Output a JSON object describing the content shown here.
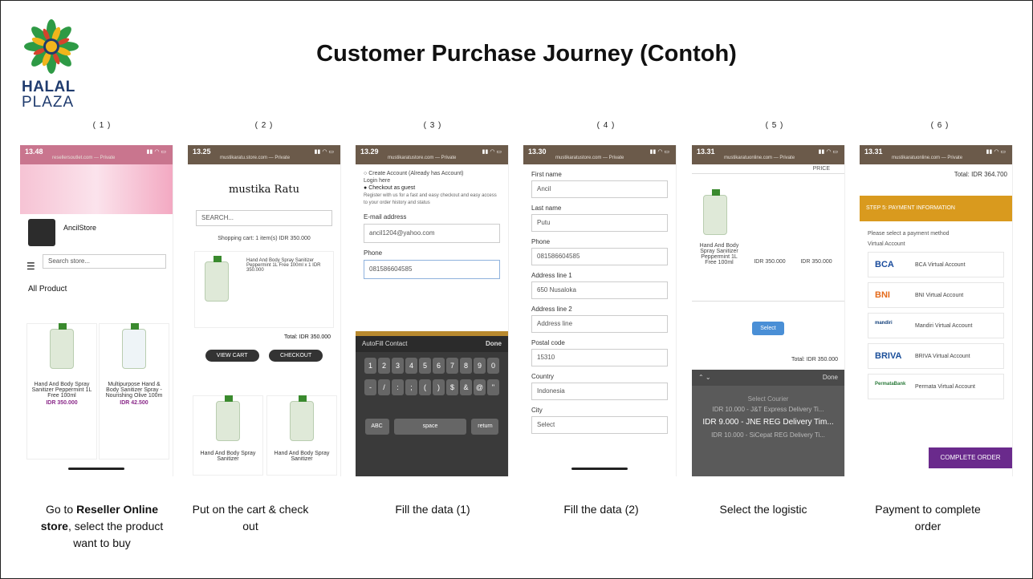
{
  "logo": {
    "line1": "HALAL",
    "line2": "PLAZA"
  },
  "title": "Customer Purchase Journey (Contoh)",
  "steps": [
    {
      "num": "( 1 )",
      "caption_pre": "Go to ",
      "caption_bold": "Reseller Online store",
      "caption_post": ", select the product want to buy"
    },
    {
      "num": "( 2 )",
      "caption": "Put on the cart & check out"
    },
    {
      "num": "( 3 )",
      "caption": "Fill the data (1)"
    },
    {
      "num": "( 4 )",
      "caption": "Fill the data (2)"
    },
    {
      "num": "( 5 )",
      "caption": "Select the logistic"
    },
    {
      "num": "( 6 )",
      "caption": "Payment to complete order"
    }
  ],
  "screen1": {
    "time": "13.48",
    "url": "resellersoutlet.com — Private",
    "store_name": "AncilStore",
    "search_placeholder": "Search store...",
    "section": "All Product",
    "products": [
      {
        "name": "Hand And Body Spray Sanitizer Peppermint 1L Free 100ml",
        "price": "IDR 350.000"
      },
      {
        "name": "Multipurpose Hand & Body Sanitizer Spray - Nourishing Olive 100m",
        "price": "IDR 42.500"
      }
    ]
  },
  "screen2": {
    "time": "13.25",
    "url": "mustikaratu.store.com — Private",
    "brand": "mustika Ratu",
    "search_placeholder": "SEARCH...",
    "cart_summary": "Shopping cart: 1 item(s) IDR 350.000",
    "item": "Hand And Body Spray Sanitizer Peppermint 1L Free 100ml x 1 IDR 350.000",
    "total": "Total: IDR 350.000",
    "view_cart": "VIEW CART",
    "checkout": "CHECKOUT",
    "products": [
      "Hand And Body Spray Sanitizer",
      "Hand And Body Spray Sanitizer"
    ]
  },
  "screen3": {
    "time": "13.29",
    "url": "mustikaratustore.com — Private",
    "opt_create": "Create Account (Already has Account)",
    "login_here": "Login here",
    "opt_guest": "Checkout as guest",
    "note": "Register with us for a fast and easy checkout and easy access to your order history and status",
    "email_label": "E-mail address",
    "email_value": "ancil1204@yahoo.com",
    "phone_label": "Phone",
    "phone_value": "081586604585",
    "autofill": "AutoFill Contact",
    "done": "Done",
    "keys_row1": [
      "1",
      "2",
      "3",
      "4",
      "5",
      "6",
      "7",
      "8",
      "9",
      "0"
    ],
    "keys_row2": [
      "-",
      "/",
      ":",
      ";",
      "(",
      ")",
      "$",
      "&",
      "@",
      "\""
    ],
    "abc": "ABC",
    "space": "space",
    "return": "return"
  },
  "screen4": {
    "time": "13.30",
    "url": "mustikaratustore.com — Private",
    "fields": [
      {
        "label": "First name",
        "value": "Ancil"
      },
      {
        "label": "Last name",
        "value": "Putu"
      },
      {
        "label": "Phone",
        "value": "081586604585"
      },
      {
        "label": "Address line 1",
        "value": "650 Nusaloka"
      },
      {
        "label": "Address line 2",
        "value": "Address line"
      },
      {
        "label": "Postal code",
        "value": "15310"
      },
      {
        "label": "Country",
        "value": "Indonesia"
      },
      {
        "label": "City",
        "value": "Select"
      }
    ]
  },
  "screen5": {
    "time": "13.31",
    "url": "mustikaratuonline.com — Private",
    "price_head": "PRICE",
    "item": "Hand And Body Spray Sanitizer Peppermint 1L Free 100ml",
    "unit_price": "IDR 350.000",
    "line_total": "IDR 350.000",
    "select": "Select",
    "total": "Total: IDR 350.000",
    "picker_title": "Select Courier",
    "done": "Done",
    "options": [
      "IDR 10.000 - J&T Express Delivery Ti...",
      "IDR 9.000 - JNE REG Delivery Tim...",
      "IDR 10.000 - SiCepat REG Delivery Ti..."
    ]
  },
  "screen6": {
    "time": "13.31",
    "url": "mustikaratuonline.com — Private",
    "total": "Total: IDR 364.700",
    "header": "STEP 5: PAYMENT INFORMATION",
    "prompt": "Please select a payment method",
    "va_label": "Virtual Account",
    "banks": [
      {
        "logo": "BCA",
        "name": "BCA Virtual Account",
        "color": "#1a4c9c"
      },
      {
        "logo": "BNI",
        "name": "BNI Virtual Account",
        "color": "#e46b1c"
      },
      {
        "logo": "mandiri",
        "name": "Mandiri Virtual Account",
        "color": "#123f7a"
      },
      {
        "logo": "BRIVA",
        "name": "BRIVA Virtual Account",
        "color": "#1b4f9a"
      },
      {
        "logo": "PermataBank",
        "name": "Permata Virtual Account",
        "color": "#2a7a3a"
      }
    ],
    "complete": "COMPLETE ORDER"
  }
}
